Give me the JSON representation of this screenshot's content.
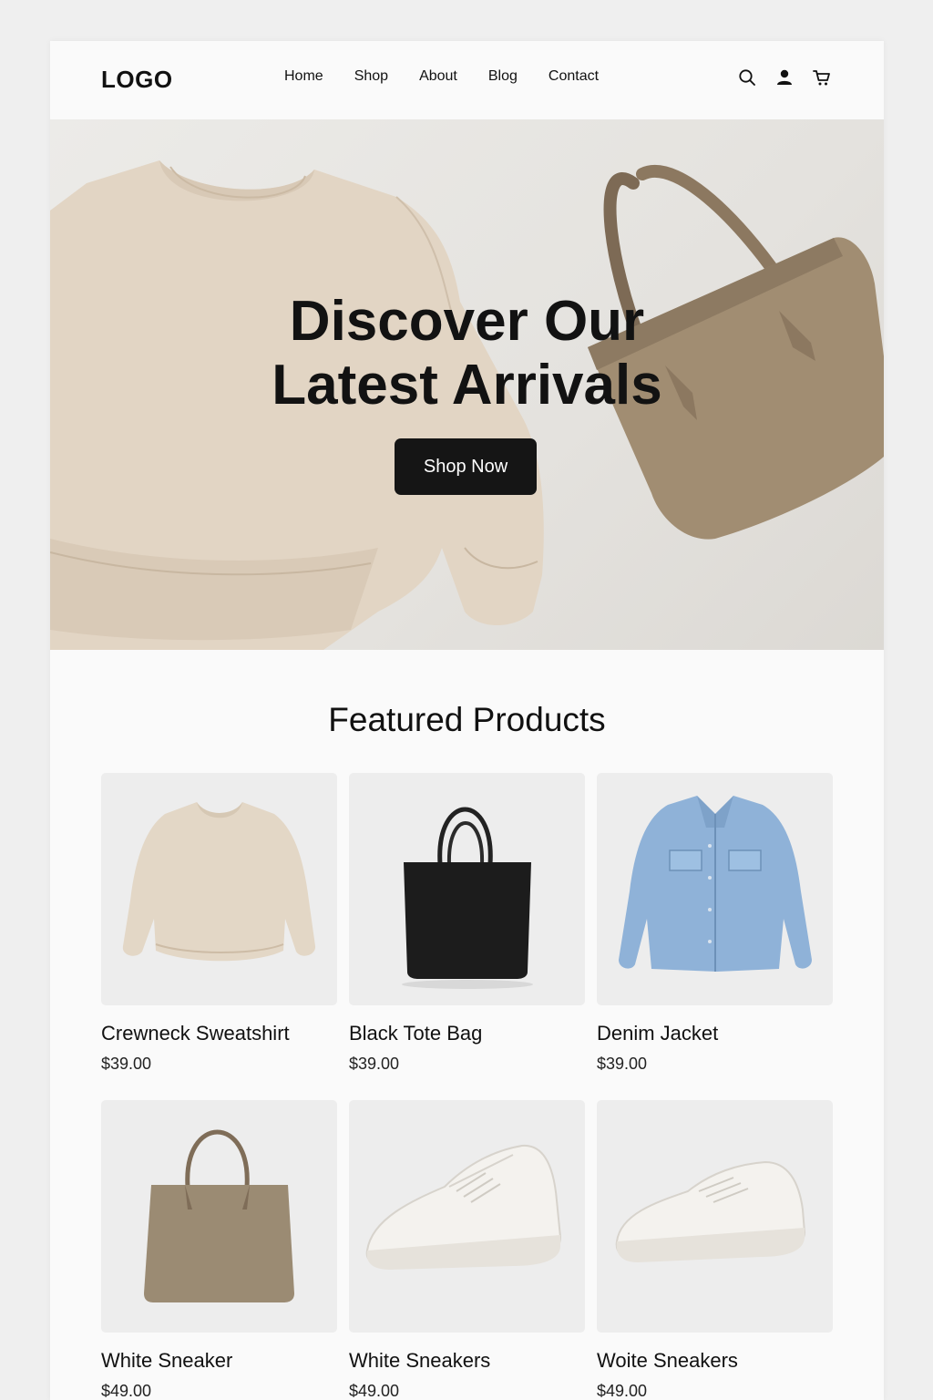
{
  "header": {
    "logo": "LOGO",
    "nav": [
      "Home",
      "Shop",
      "About",
      "Blog",
      "Contact"
    ],
    "icons": [
      "search-icon",
      "user-icon",
      "cart-icon"
    ]
  },
  "hero": {
    "title_line1": "Discover Our",
    "title_line2": "Latest Arrivals",
    "cta": "Shop Now"
  },
  "featured": {
    "title": "Featured Products",
    "products": [
      {
        "name": "Crewneck Sweatshirt",
        "price": "$39.00",
        "image": "beige-sweatshirt"
      },
      {
        "name": "Black Tote Bag",
        "price": "$39.00",
        "image": "black-tote-bag"
      },
      {
        "name": "Denim Jacket",
        "price": "$39.00",
        "image": "denim-jacket"
      },
      {
        "name": "White Sneaker",
        "price": "$49.00",
        "image": "taupe-tote-bag"
      },
      {
        "name": "White Sneakers",
        "price": "$49.00",
        "image": "white-sneakers"
      },
      {
        "name": "Woite Sneakers",
        "price": "$49.00",
        "image": "white-sneakers"
      }
    ]
  },
  "colors": {
    "accent": "#151515",
    "background": "#fafafa",
    "card_bg": "#ededed"
  }
}
